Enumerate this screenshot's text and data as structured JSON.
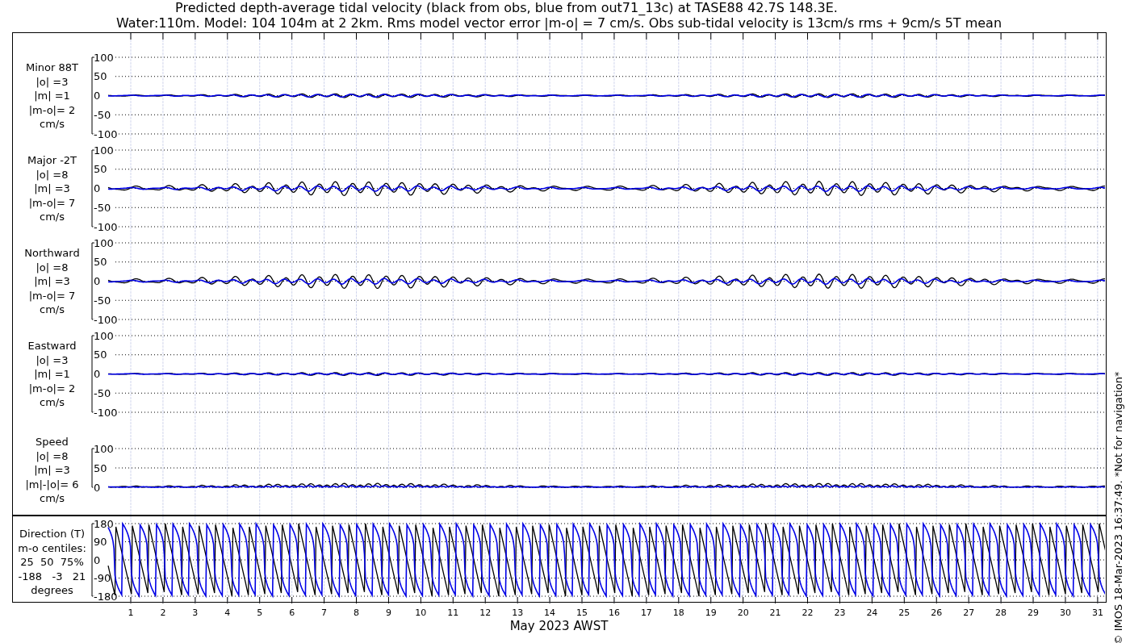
{
  "title_lines": [
    "Predicted depth-average tidal velocity (black from obs, blue from out71_13c) at TASE88 42.7S 148.3E.",
    "Water:110m. Model: 104 104m at 2 2km. Rms model vector error |m-o| = 7 cm/s. Obs sub-tidal velocity is 13cm/s rms + 9cm/s 5T mean"
  ],
  "panels": [
    {
      "kind": "velocity",
      "label_lines": [
        "Minor 88T",
        "|o| =3",
        "|m| =1",
        "|m-o|= 2",
        "cm/s"
      ],
      "yticks": [
        "100",
        "50",
        "0",
        "-50",
        "-100"
      ]
    },
    {
      "kind": "velocity",
      "label_lines": [
        "Major -2T",
        "|o| =8",
        "|m| =3",
        "|m-o|= 7",
        "cm/s"
      ],
      "yticks": [
        "100",
        "50",
        "0",
        "-50",
        "-100"
      ]
    },
    {
      "kind": "velocity",
      "label_lines": [
        "Northward",
        "|o| =8",
        "|m| =3",
        "|m-o|= 7",
        "cm/s"
      ],
      "yticks": [
        "100",
        "50",
        "0",
        "-50",
        "-100"
      ]
    },
    {
      "kind": "velocity",
      "label_lines": [
        "Eastward",
        "|o| =3",
        "|m| =1",
        "|m-o|= 2",
        "cm/s"
      ],
      "yticks": [
        "100",
        "50",
        "0",
        "-50",
        "-100"
      ]
    },
    {
      "kind": "speed",
      "label_lines": [
        "Speed",
        "|o| =8",
        "|m| =3",
        "|m|-|o|= 6",
        "cm/s"
      ],
      "yticks": [
        "100",
        "50",
        "0"
      ]
    },
    {
      "kind": "direction",
      "label_lines": [
        "Direction (T)",
        "m-o centiles:",
        "25  50  75%",
        "-188   -3   21",
        "degrees"
      ],
      "yticks": [
        "180",
        "90",
        "0",
        "-90",
        "-180"
      ]
    }
  ],
  "x_axis": {
    "ticks": [
      "1",
      "2",
      "3",
      "4",
      "5",
      "6",
      "7",
      "8",
      "9",
      "10",
      "11",
      "12",
      "13",
      "14",
      "15",
      "16",
      "17",
      "18",
      "19",
      "20",
      "21",
      "22",
      "23",
      "24",
      "25",
      "26",
      "27",
      "28",
      "29",
      "30",
      "31"
    ],
    "label": "May 2023 AWST"
  },
  "footer": "© IMOS 18-Mar-2023 16:37:49. *Not for navigation*"
}
